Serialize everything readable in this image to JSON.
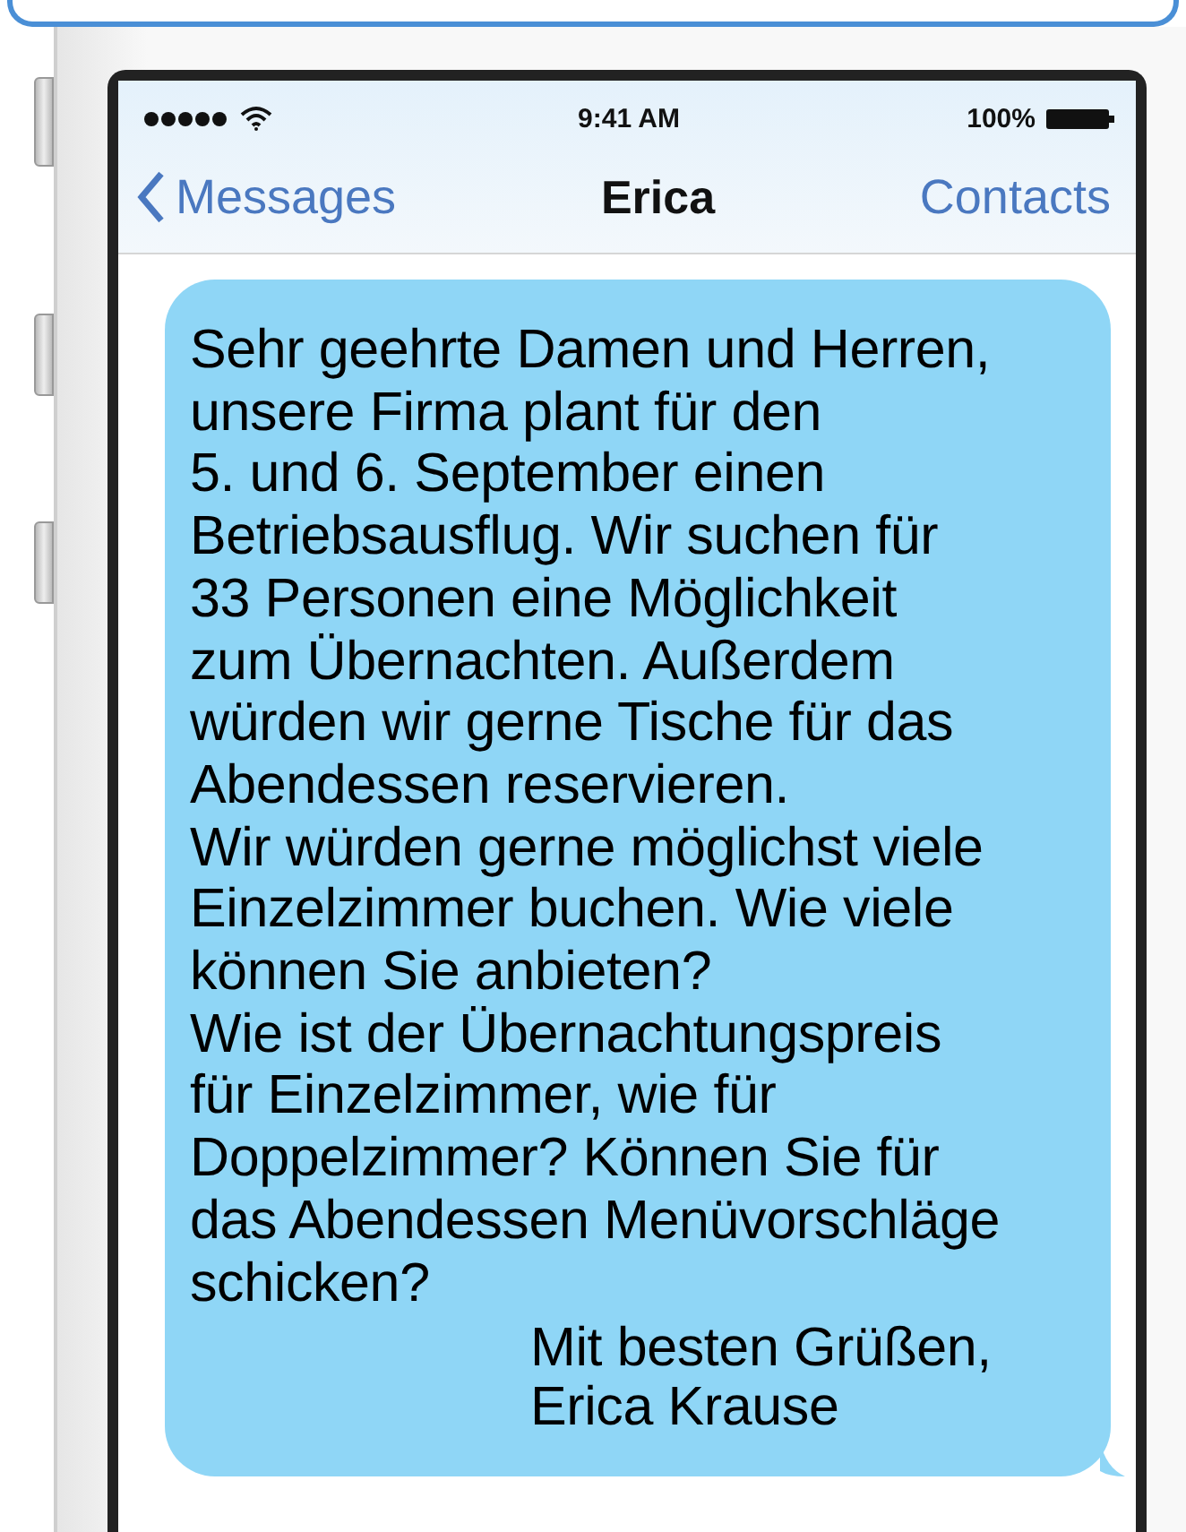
{
  "status_bar": {
    "time": "9:41 AM",
    "battery": "100%"
  },
  "nav": {
    "back": "Messages",
    "title": "Erica",
    "action": "Contacts"
  },
  "message": {
    "body": "Sehr geehrte Damen und Herren,\nunsere Firma plant für den\n5. und 6. September einen\nBetriebsausflug. Wir suchen für\n33 Personen eine Möglichkeit\nzum Übernachten. Außerdem\nwürden wir gerne Tische für das\nAbendessen reservieren.\nWir würden gerne möglichst viele\nEinzelzimmer buchen. Wie viele\nkönnen Sie anbieten?\nWie ist der Übernachtungspreis\nfür Einzelzimmer, wie für\nDoppelzimmer? Können Sie für\ndas Abendessen Menüvorschläge\nschicken?",
    "signature": "Mit besten Grüßen,\nErica Krause"
  }
}
